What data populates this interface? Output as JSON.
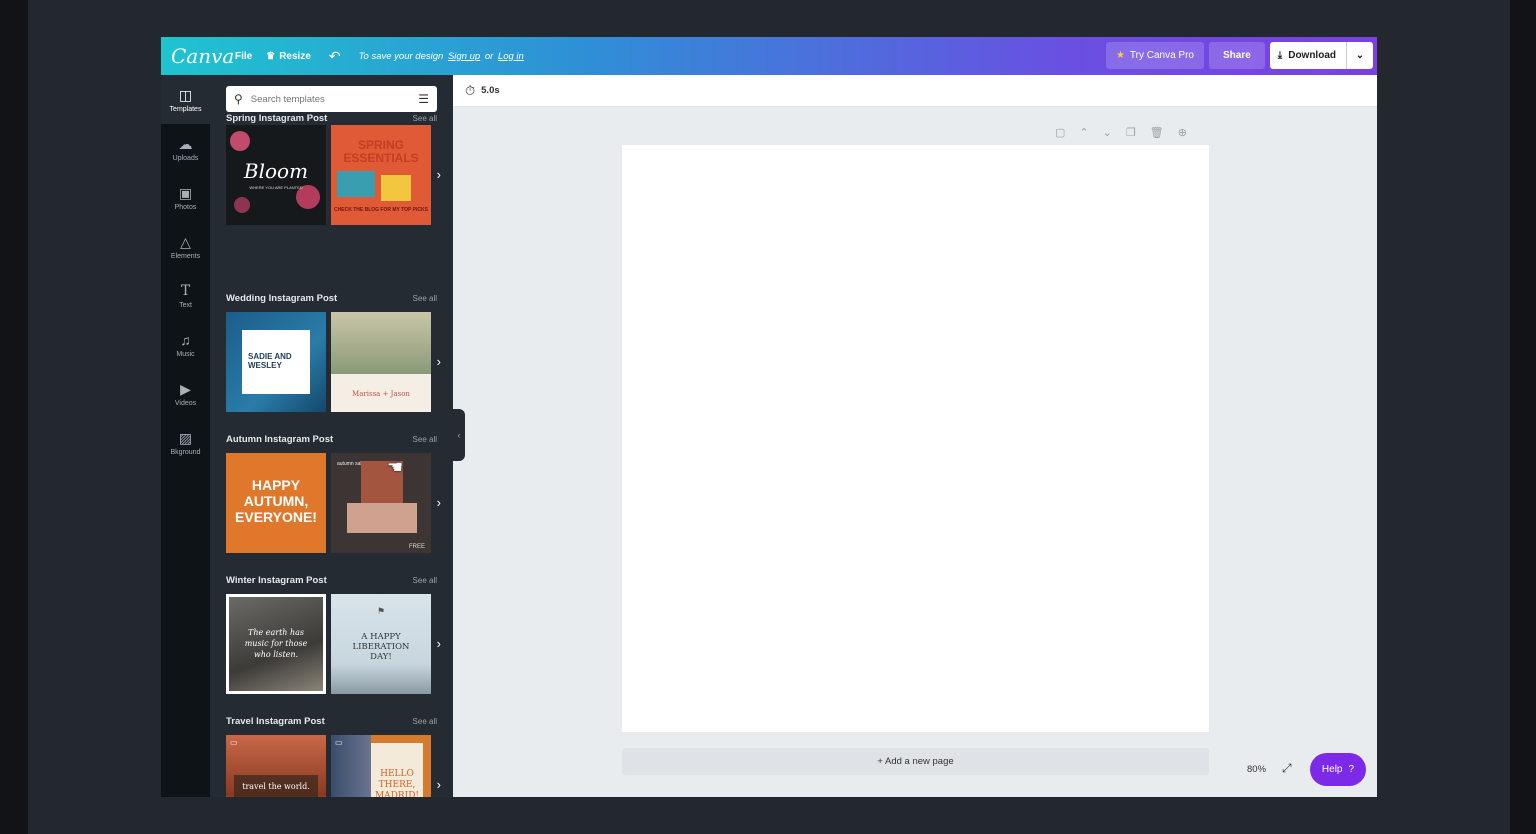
{
  "topbar": {
    "logo": "Canva",
    "file": "File",
    "resize": "Resize",
    "save_text": "To save your design",
    "signup": "Sign up",
    "or": "or",
    "login": "Log in",
    "try_pro": "Try Canva Pro",
    "share": "Share",
    "download": "Download"
  },
  "rail": [
    {
      "label": "Templates",
      "icon": "layout-icon"
    },
    {
      "label": "Uploads",
      "icon": "upload-icon"
    },
    {
      "label": "Photos",
      "icon": "photo-icon"
    },
    {
      "label": "Elements",
      "icon": "shapes-icon"
    },
    {
      "label": "Text",
      "icon": "text-icon"
    },
    {
      "label": "Music",
      "icon": "music-icon"
    },
    {
      "label": "Videos",
      "icon": "video-icon"
    },
    {
      "label": "Bkground",
      "icon": "background-icon"
    }
  ],
  "search": {
    "placeholder": "Search templates"
  },
  "sections": [
    {
      "title": "Spring Instagram Post",
      "see_all": "See all",
      "thumb1": {
        "main": "Bloom",
        "sub": "WHERE YOU ARE PLANTED"
      },
      "thumb2": {
        "main": "SPRING ESSENTIALS",
        "sub": "CHECK THE BLOG FOR MY TOP PICKS"
      }
    },
    {
      "title": "Wedding Instagram Post",
      "see_all": "See all",
      "thumb1": {
        "main": "SADIE AND WESLEY"
      },
      "thumb2": {
        "main": "Marissa + Jason"
      }
    },
    {
      "title": "Autumn Instagram Post",
      "see_all": "See all",
      "thumb1": {
        "main": "HAPPY AUTUMN, EVERYONE!"
      },
      "thumb2": {
        "main": "autumn sale",
        "badge": "FREE"
      }
    },
    {
      "title": "Winter Instagram Post",
      "see_all": "See all",
      "thumb1": {
        "main": "The earth has music for those who listen."
      },
      "thumb2": {
        "main": "A HAPPY LIBERATION DAY!"
      }
    },
    {
      "title": "Travel Instagram Post",
      "see_all": "See all",
      "thumb1": {
        "main": "travel the world."
      },
      "thumb2": {
        "main": "HELLO THERE, MADRID!"
      }
    }
  ],
  "canvas": {
    "duration": "5.0s",
    "add_page": "+ Add a new page",
    "zoom": "80%",
    "help": "Help",
    "help_icon": "?"
  }
}
